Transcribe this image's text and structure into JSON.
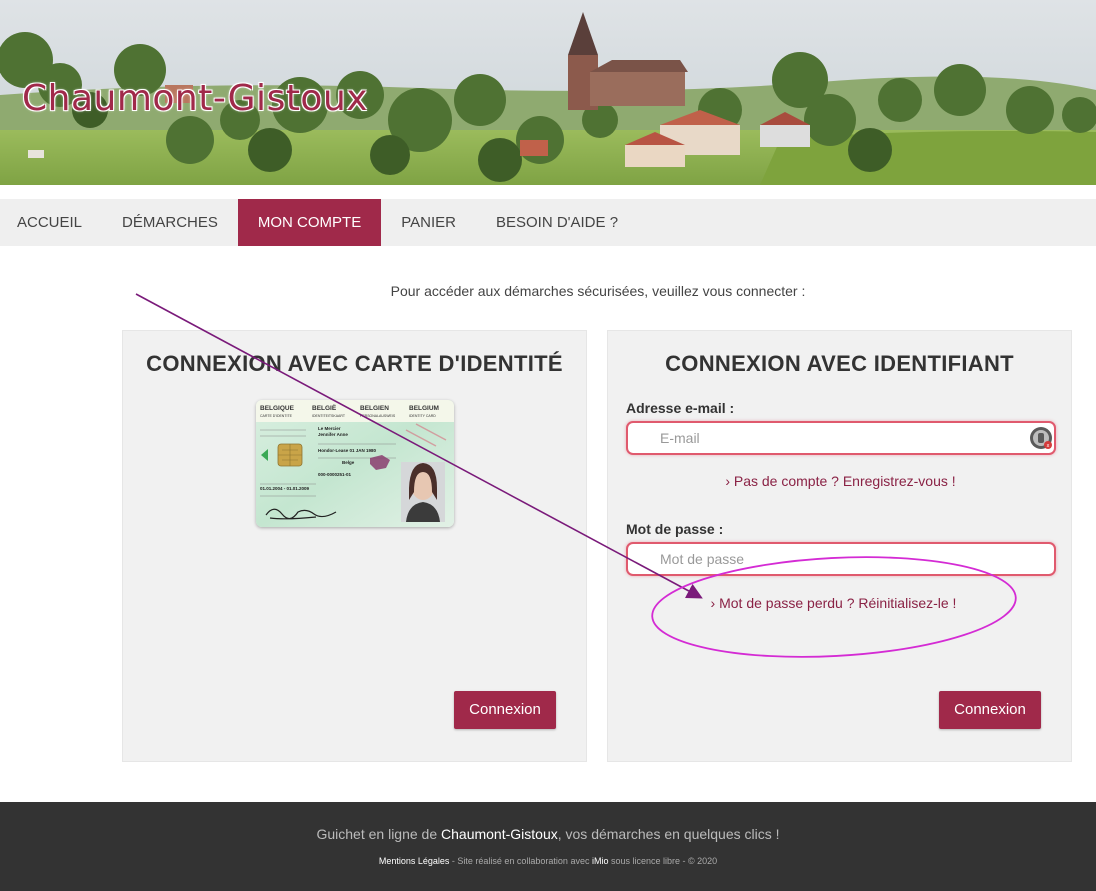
{
  "site": {
    "title": "Chaumont-Gistoux"
  },
  "nav": {
    "items": [
      {
        "label": "ACCUEIL",
        "active": false
      },
      {
        "label": "DÉMARCHES",
        "active": false
      },
      {
        "label": "MON COMPTE",
        "active": true
      },
      {
        "label": "PANIER",
        "active": false
      },
      {
        "label": "BESOIN D'AIDE ?",
        "active": false
      }
    ]
  },
  "intro": "Pour accéder aux démarches sécurisées, veuillez vous connecter :",
  "eid_panel": {
    "title": "CONNEXION AVEC CARTE D'IDENTITÉ",
    "button": "Connexion",
    "card": {
      "header": [
        "BELGIQUE",
        "BELGIË",
        "BELGIEN",
        "BELGIUM"
      ],
      "subheader": [
        "CARTE D'IDENTITE",
        "IDENTITEITSKAART",
        "PERSONALAUSWEIS",
        "IDENTITY CARD"
      ],
      "surname": "Le Mercier",
      "given_name": "Jennifer Anne",
      "birth": "Hondor-Lease 01 JAN 1980",
      "nationality": "Belge",
      "number": "000-0000251-01",
      "validity": "01.01.2004 - 01.01.2009"
    }
  },
  "login_panel": {
    "title": "CONNEXION AVEC IDENTIFIANT",
    "email_label": "Adresse e-mail :",
    "email_placeholder": "E-mail",
    "register_link": "› Pas de compte ? Enregistrez-vous !",
    "password_label": "Mot de passe :",
    "password_placeholder": "Mot de passe",
    "reset_link": "› Mot de passe perdu ? Réinitialisez-le !",
    "button": "Connexion"
  },
  "footer": {
    "prefix": "Guichet en ligne de ",
    "town": "Chaumont-Gistoux",
    "suffix": ", vos démarches en quelques clics !",
    "legal": "Mentions Légales",
    "credit_middle": " - Site réalisé en collaboration avec ",
    "partner": "iMio",
    "credit_end": " sous licence libre - © 2020"
  },
  "colors": {
    "accent": "#a0294a",
    "annotation": "#7a1a7a",
    "highlight": "#d42bd4",
    "footer_bg": "#333333"
  }
}
